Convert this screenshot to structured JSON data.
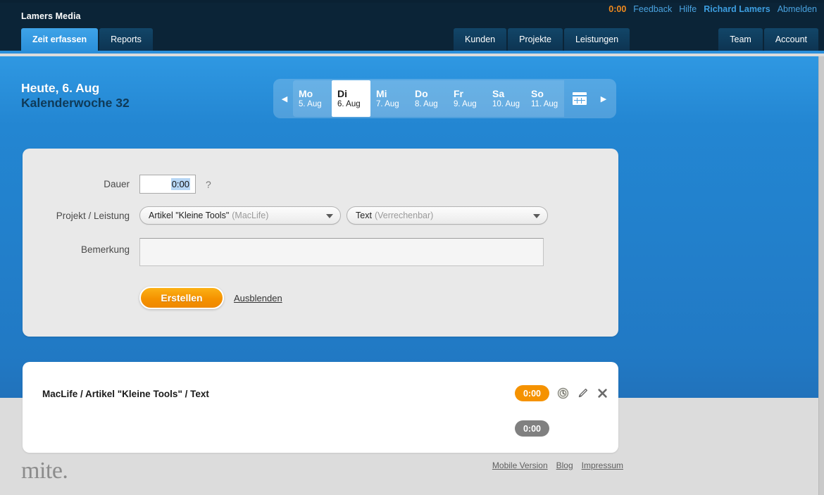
{
  "header": {
    "brand": "Lamers Media",
    "utility": {
      "timer": "0:00",
      "feedback": "Feedback",
      "help": "Hilfe",
      "user": "Richard Lamers",
      "logout": "Abmelden"
    },
    "tabs_left": [
      {
        "label": "Zeit erfassen",
        "active": true
      },
      {
        "label": "Reports",
        "active": false
      }
    ],
    "tabs_mid": [
      {
        "label": "Kunden"
      },
      {
        "label": "Projekte"
      },
      {
        "label": "Leistungen"
      }
    ],
    "tabs_right": [
      {
        "label": "Team"
      },
      {
        "label": "Account"
      }
    ]
  },
  "datebar": {
    "today_label": "Heute, 6. Aug",
    "week_label": "Kalenderwoche 32",
    "prev_arrow": "◀",
    "next_arrow": "▶",
    "days": [
      {
        "weekday": "Mo",
        "date": "5. Aug",
        "active": false
      },
      {
        "weekday": "Di",
        "date": "6. Aug",
        "active": true
      },
      {
        "weekday": "Mi",
        "date": "7. Aug",
        "active": false
      },
      {
        "weekday": "Do",
        "date": "8. Aug",
        "active": false
      },
      {
        "weekday": "Fr",
        "date": "9. Aug",
        "active": false
      },
      {
        "weekday": "Sa",
        "date": "10. Aug",
        "active": false
      },
      {
        "weekday": "So",
        "date": "11. Aug",
        "active": false
      }
    ]
  },
  "form": {
    "dauer_label": "Dauer",
    "dauer_value": "0:00",
    "help_marker": "?",
    "projekt_label": "Projekt / Leistung",
    "projekt_value": "Artikel \"Kleine Tools\"",
    "projekt_meta": "(MacLife)",
    "leistung_value": "Text",
    "leistung_meta": "(Verrechenbar)",
    "bemerkung_label": "Bemerkung",
    "bemerkung_value": "",
    "bemerkung_placeholder": "",
    "create_button": "Erstellen",
    "hide_link": "Ausblenden"
  },
  "entry": {
    "title": "MacLife / Artikel \"Kleine Tools\" / Text",
    "duration_badge": "0:00",
    "total_badge": "0:00",
    "icons": {
      "timer": "timer-icon",
      "edit": "pencil-icon",
      "delete": "close-icon"
    }
  },
  "footer": {
    "logo": "mite.",
    "links": [
      "Mobile Version",
      "Blog",
      "Impressum"
    ]
  },
  "colors": {
    "accent_orange": "#f59200",
    "brand_blue": "#2b8fdb",
    "header_dark": "#0b2437",
    "panel_gray": "#e9e9e9"
  }
}
